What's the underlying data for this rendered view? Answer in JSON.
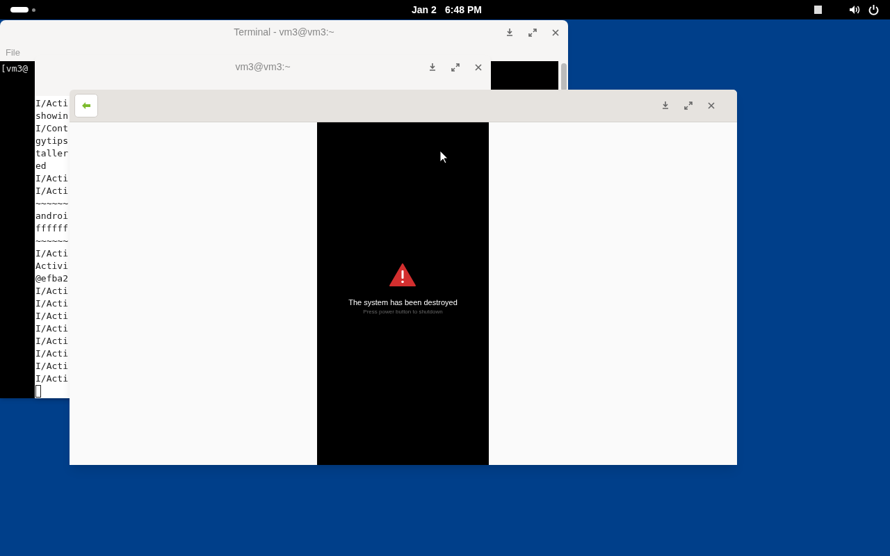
{
  "top_bar": {
    "date": "Jan 2",
    "time": "6:48 PM"
  },
  "terminals": [
    {
      "kind": "dark",
      "title": "Terminal - vm3@vm3:~",
      "menu": [
        "File"
      ],
      "lines": [
        "[vm3@"
      ]
    },
    {
      "kind": "light",
      "title": "vm3@vm3:~",
      "lines": [
        "I/Acti",
        "showin",
        "I/Cont",
        "gytips",
        "taller",
        "ed",
        "I/Acti",
        "I/Acti",
        "~~~~~~",
        "androi",
        "ffffff",
        "~~~~~~",
        "I/Acti",
        "Activi",
        "@efba2",
        "I/Acti",
        "I/Acti",
        "I/Acti",
        "I/Acti",
        "I/Acti",
        "I/Acti",
        "I/Acti",
        "I/Acti"
      ]
    }
  ],
  "emulator_window": {
    "message": "The system has been destroyed",
    "hint": "Press power button to shutdown"
  }
}
